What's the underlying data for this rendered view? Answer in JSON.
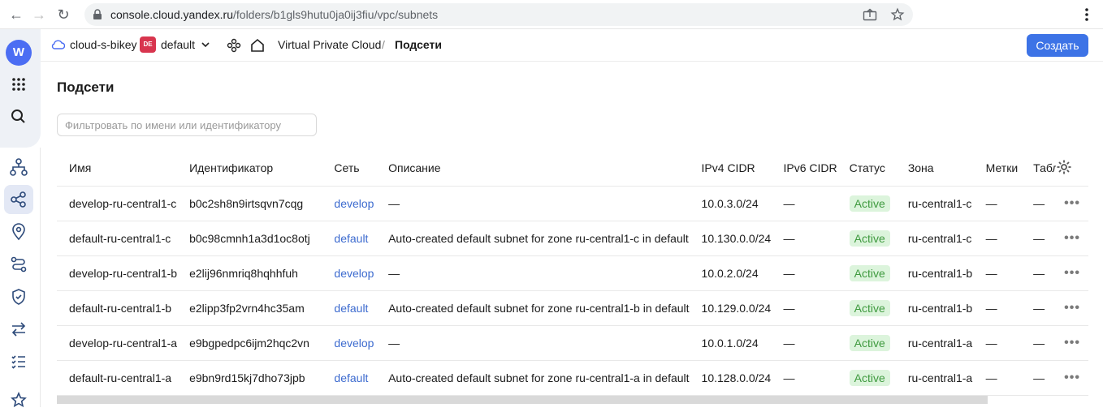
{
  "browser": {
    "url_host": "console.cloud.yandex.ru",
    "url_path": "/folders/b1gls9hutu0ja0ij3fiu/vpc/subnets"
  },
  "sidebar": {
    "logo_letter": "W",
    "icons": [
      "apps-grid-icon",
      "search-icon",
      "network-topology-icon",
      "subnets-icon",
      "location-pin-icon",
      "routes-icon",
      "security-shield-icon",
      "arrows-exchange-icon",
      "checklist-icon",
      "star-icon"
    ]
  },
  "header": {
    "cloud_name": "cloud-s-bikey",
    "folder_badge": "DE",
    "folder_name": "default",
    "breadcrumb_service": "Virtual Private Cloud",
    "breadcrumb_separator": "/",
    "breadcrumb_current": "Подсети",
    "create_label": "Создать"
  },
  "main": {
    "title": "Подсети",
    "filter_placeholder": "Фильтровать по имени или идентификатору"
  },
  "table": {
    "columns": [
      "Имя",
      "Идентификатор",
      "Сеть",
      "Описание",
      "IPv4 CIDR",
      "IPv6 CIDR",
      "Статус",
      "Зона",
      "Метки",
      "Табл"
    ],
    "rows": [
      {
        "name": "develop-ru-central1-c",
        "id": "b0c2sh8n9irtsqvn7cqg",
        "network": "develop",
        "description": "—",
        "ipv4": "10.0.3.0/24",
        "ipv6": "—",
        "status": "Active",
        "zone": "ru-central1-c",
        "labels": "—",
        "table": "—"
      },
      {
        "name": "default-ru-central1-c",
        "id": "b0c98cmnh1a3d1oc8otj",
        "network": "default",
        "description": "Auto-created default subnet for zone ru-central1-c in default",
        "ipv4": "10.130.0.0/24",
        "ipv6": "—",
        "status": "Active",
        "zone": "ru-central1-c",
        "labels": "—",
        "table": "—"
      },
      {
        "name": "develop-ru-central1-b",
        "id": "e2lij96nmriq8hqhhfuh",
        "network": "develop",
        "description": "—",
        "ipv4": "10.0.2.0/24",
        "ipv6": "—",
        "status": "Active",
        "zone": "ru-central1-b",
        "labels": "—",
        "table": "—"
      },
      {
        "name": "default-ru-central1-b",
        "id": "e2lipp3fp2vrn4hc35am",
        "network": "default",
        "description": "Auto-created default subnet for zone ru-central1-b in default",
        "ipv4": "10.129.0.0/24",
        "ipv6": "—",
        "status": "Active",
        "zone": "ru-central1-b",
        "labels": "—",
        "table": "—"
      },
      {
        "name": "develop-ru-central1-a",
        "id": "e9bgpedpc6ijm2hqc2vn",
        "network": "develop",
        "description": "—",
        "ipv4": "10.0.1.0/24",
        "ipv6": "—",
        "status": "Active",
        "zone": "ru-central1-a",
        "labels": "—",
        "table": "—"
      },
      {
        "name": "default-ru-central1-a",
        "id": "e9bn9rd15kj7dho73jpb",
        "network": "default",
        "description": "Auto-created default subnet for zone ru-central1-a in default",
        "ipv4": "10.128.0.0/24",
        "ipv6": "—",
        "status": "Active",
        "zone": "ru-central1-a",
        "labels": "—",
        "table": "—"
      }
    ]
  },
  "colors": {
    "accent": "#3d73e6",
    "status_active_bg": "#dcf4dc",
    "status_active_text": "#3f9a3f",
    "folder_badge": "#d8354e"
  }
}
